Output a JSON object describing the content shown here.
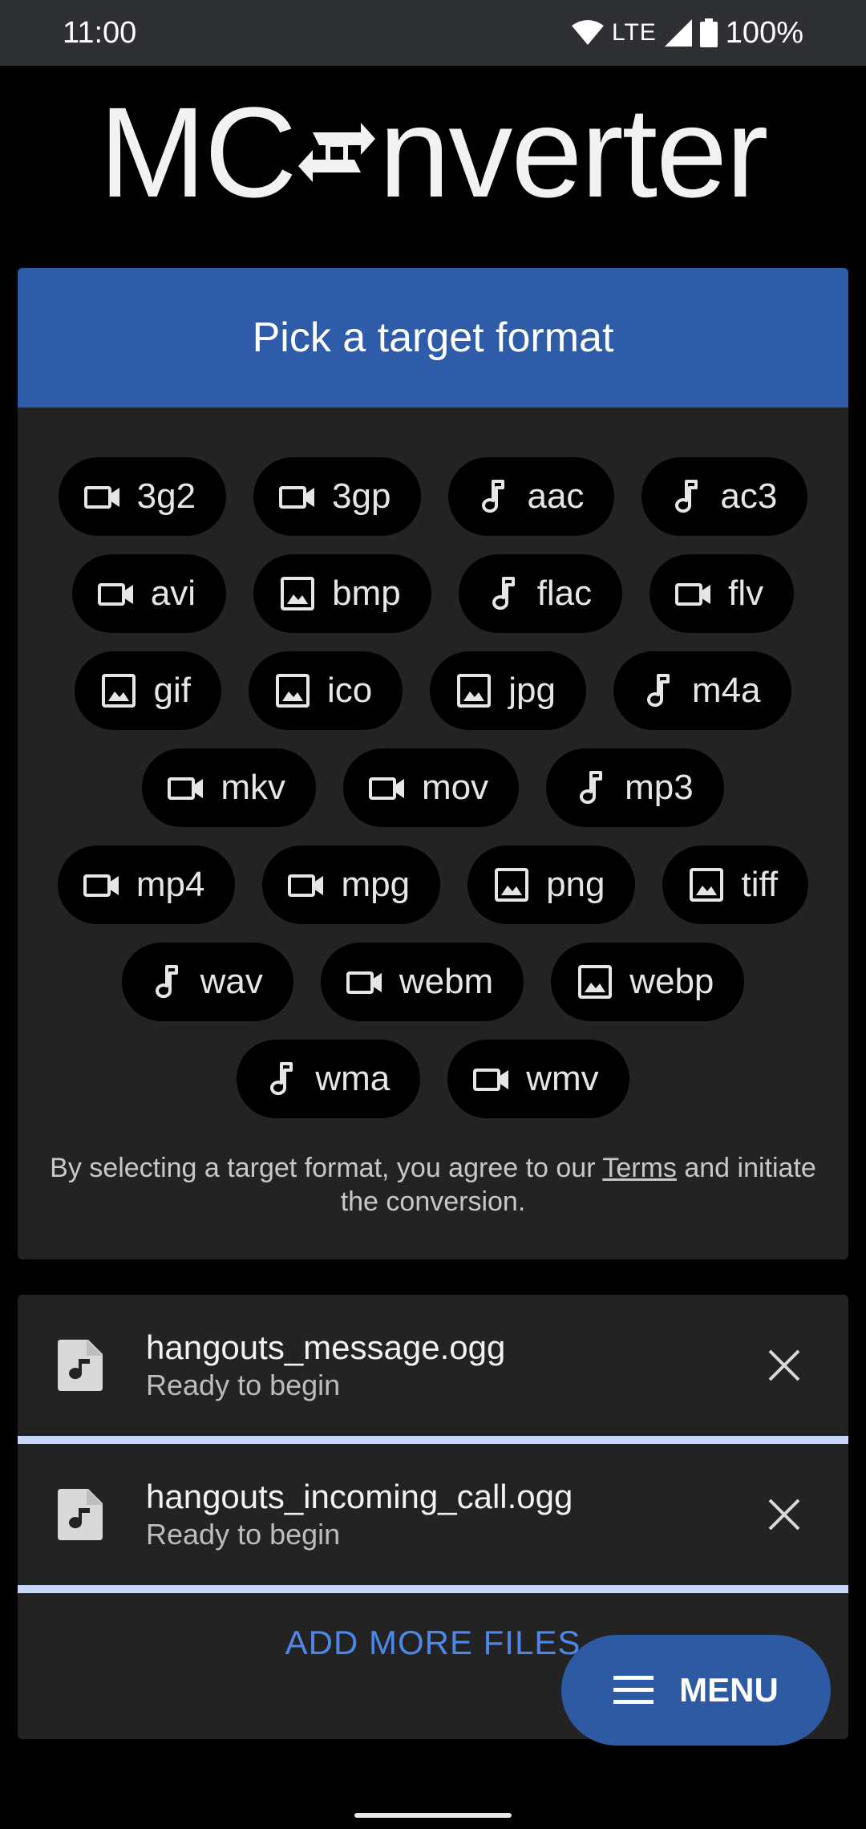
{
  "status_bar": {
    "time": "11:00",
    "network": "LTE",
    "battery": "100%"
  },
  "logo": {
    "left_text": "MC",
    "right_text": "nverter"
  },
  "format_picker": {
    "title": "Pick a target format",
    "rows": [
      [
        {
          "label": "3g2",
          "icon": "video-icon"
        },
        {
          "label": "3gp",
          "icon": "video-icon"
        },
        {
          "label": "aac",
          "icon": "music-note-icon"
        },
        {
          "label": "ac3",
          "icon": "music-note-icon"
        }
      ],
      [
        {
          "label": "avi",
          "icon": "video-icon"
        },
        {
          "label": "bmp",
          "icon": "image-icon"
        },
        {
          "label": "flac",
          "icon": "music-note-icon"
        },
        {
          "label": "flv",
          "icon": "video-icon"
        }
      ],
      [
        {
          "label": "gif",
          "icon": "image-icon"
        },
        {
          "label": "ico",
          "icon": "image-icon"
        },
        {
          "label": "jpg",
          "icon": "image-icon"
        },
        {
          "label": "m4a",
          "icon": "music-note-icon"
        }
      ],
      [
        {
          "label": "mkv",
          "icon": "video-icon"
        },
        {
          "label": "mov",
          "icon": "video-icon"
        },
        {
          "label": "mp3",
          "icon": "music-note-icon"
        }
      ],
      [
        {
          "label": "mp4",
          "icon": "video-icon"
        },
        {
          "label": "mpg",
          "icon": "video-icon"
        },
        {
          "label": "png",
          "icon": "image-icon"
        },
        {
          "label": "tiff",
          "icon": "image-icon"
        }
      ],
      [
        {
          "label": "wav",
          "icon": "music-note-icon"
        },
        {
          "label": "webm",
          "icon": "video-icon"
        },
        {
          "label": "webp",
          "icon": "image-icon"
        }
      ],
      [
        {
          "label": "wma",
          "icon": "music-note-icon"
        },
        {
          "label": "wmv",
          "icon": "video-icon"
        }
      ]
    ],
    "terms_before": "By selecting a target format, you agree to our ",
    "terms_link": "Terms",
    "terms_after": " and initiate the conversion."
  },
  "files": [
    {
      "name": "hangouts_message.ogg",
      "status": "Ready to begin"
    },
    {
      "name": "hangouts_incoming_call.ogg",
      "status": "Ready to begin"
    }
  ],
  "add_more_label": "ADD MORE FILES",
  "fab_label": "MENU",
  "colors": {
    "header_blue": "#2f5ca8",
    "link_blue": "#4f86e8",
    "progress": "#c7d8f8"
  }
}
